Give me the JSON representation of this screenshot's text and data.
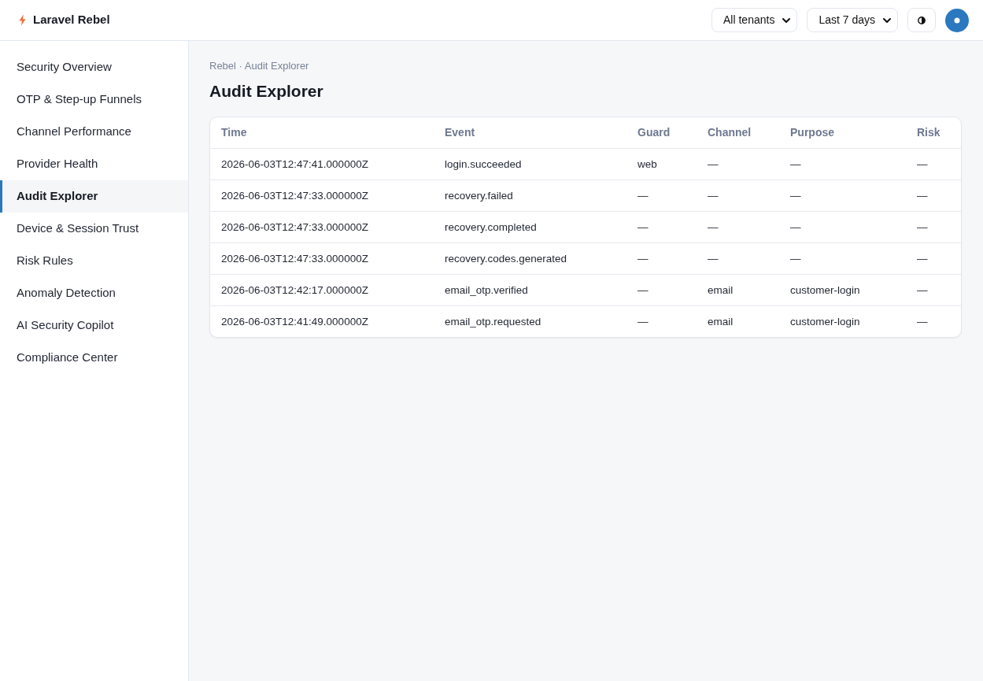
{
  "header": {
    "brand": "Laravel Rebel",
    "filters": [
      {
        "value": "All tenants"
      },
      {
        "value": "Last 7 days"
      }
    ]
  },
  "sidebar": {
    "items": [
      {
        "label": "Security Overview",
        "selected": false
      },
      {
        "label": "OTP & Step-up Funnels",
        "selected": false
      },
      {
        "label": "Channel Performance",
        "selected": false
      },
      {
        "label": "Provider Health",
        "selected": false
      },
      {
        "label": "Audit Explorer",
        "selected": true
      },
      {
        "label": "Device & Session Trust",
        "selected": false
      },
      {
        "label": "Risk Rules",
        "selected": false
      },
      {
        "label": "Anomaly Detection",
        "selected": false
      },
      {
        "label": "AI Security Copilot",
        "selected": false
      },
      {
        "label": "Compliance Center",
        "selected": false
      }
    ]
  },
  "page": {
    "breadcrumb": "Rebel · Audit Explorer",
    "title": "Audit Explorer"
  },
  "table": {
    "columns": [
      "Time",
      "Event",
      "Guard",
      "Channel",
      "Purpose",
      "Risk"
    ],
    "rows": [
      [
        "2026-06-03T12:47:41.000000Z",
        "login.succeeded",
        "web",
        "—",
        "—",
        "—"
      ],
      [
        "2026-06-03T12:47:33.000000Z",
        "recovery.failed",
        "—",
        "—",
        "—",
        "—"
      ],
      [
        "2026-06-03T12:47:33.000000Z",
        "recovery.completed",
        "—",
        "—",
        "—",
        "—"
      ],
      [
        "2026-06-03T12:47:33.000000Z",
        "recovery.codes.generated",
        "—",
        "—",
        "—",
        "—"
      ],
      [
        "2026-06-03T12:42:17.000000Z",
        "email_otp.verified",
        "—",
        "email",
        "customer-login",
        "—"
      ],
      [
        "2026-06-03T12:41:49.000000Z",
        "email_otp.requested",
        "—",
        "email",
        "customer-login",
        "—"
      ]
    ]
  }
}
